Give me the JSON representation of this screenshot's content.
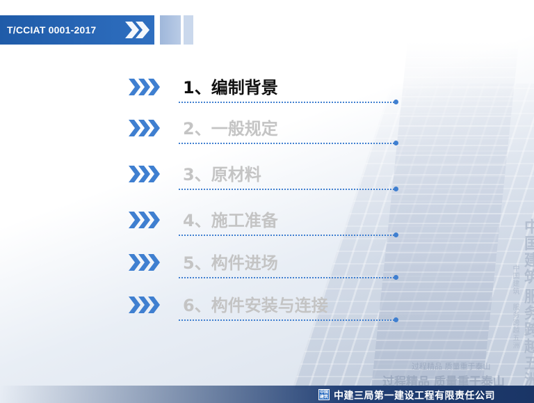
{
  "header": {
    "title": "T/CCIAT 0001-2017"
  },
  "menu": {
    "items": [
      {
        "label": "1、编制背景",
        "active": true
      },
      {
        "label": "2、一般规定",
        "active": false
      },
      {
        "label": "3、原材料",
        "active": false
      },
      {
        "label": "4、施工准备",
        "active": false
      },
      {
        "label": "5、构件进场",
        "active": false
      },
      {
        "label": "6、构件安装与连接",
        "active": false
      }
    ]
  },
  "slogans": {
    "vertical_big_1": "中国建筑",
    "vertical_big_2": "服务跨越五洲",
    "vertical_small_1": "中国建筑",
    "vertical_small_2": "服务跨越五洲",
    "row_small": "过程精品  质量重于泰山",
    "row_big": "过程精品  质量重于泰山"
  },
  "footer": {
    "logo_text": "中国建筑",
    "company": "中建三局第一建设工程有限责任公司"
  },
  "colors": {
    "accent_blue": "#2f6fc0",
    "chevron_blue": "#3f7fd0",
    "inactive_text": "#c4c4c4",
    "active_text": "#111111",
    "footer_navy": "#1a3566"
  }
}
